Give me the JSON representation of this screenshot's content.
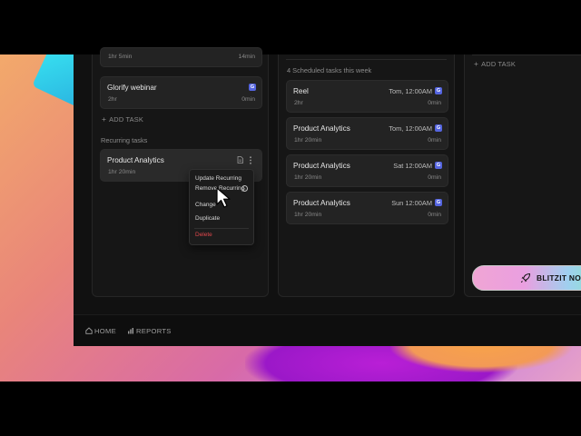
{
  "colors": {
    "app_bg": "#111111",
    "card_bg": "#232323",
    "calendar_icon": "#5565e0",
    "delete_red": "#e0474c"
  },
  "column1": {
    "top_card": {
      "duration": "1hr 5min",
      "right_time": "14min"
    },
    "webinar_card": {
      "title": "Glorify webinar",
      "duration": "2hr",
      "right_time": "0min",
      "icon": "google-calendar-icon"
    },
    "add_task": "ADD TASK",
    "recurring_label": "Recurring tasks",
    "recurring_card": {
      "title": "Product Analytics",
      "duration": "1hr 20min"
    }
  },
  "context_menu": {
    "update": "Update Recurring",
    "remove": "Remove Recurring",
    "change": "Change",
    "duplicate": "Duplicate",
    "delete": "Delete"
  },
  "column2": {
    "header": "4 Scheduled tasks this week",
    "tasks": [
      {
        "title": "Reel",
        "date": "Tom, 12:00AM",
        "duration": "2hr",
        "right_time": "0min"
      },
      {
        "title": "Product Analytics",
        "date": "Tom, 12:00AM",
        "duration": "1hr 20min",
        "right_time": "0min"
      },
      {
        "title": "Product Analytics",
        "date": "Sat 12:00AM",
        "duration": "1hr 20min",
        "right_time": "0min"
      },
      {
        "title": "Product Analytics",
        "date": "Sun 12:00AM",
        "duration": "1hr 20min",
        "right_time": "0min"
      }
    ]
  },
  "column3": {
    "add_task": "ADD TASK"
  },
  "blitz_button": "BLITZIT NOW",
  "footer": {
    "home": "HOME",
    "reports": "REPORTS"
  }
}
